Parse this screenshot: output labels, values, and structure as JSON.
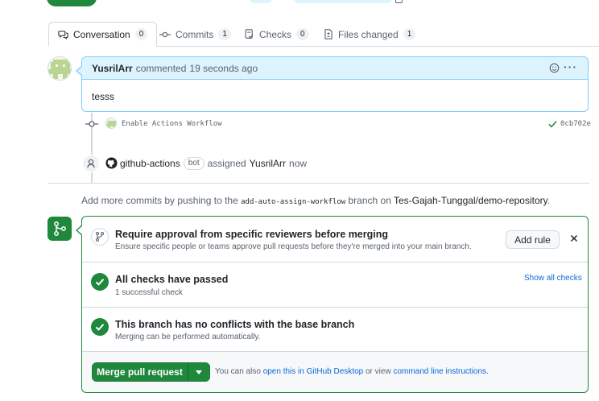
{
  "tabs": [
    {
      "label": "Conversation",
      "count": "0",
      "icon": "comment-discussion-icon"
    },
    {
      "label": "Commits",
      "count": "1",
      "icon": "git-commit-icon"
    },
    {
      "label": "Checks",
      "count": "0",
      "icon": "checklist-icon"
    },
    {
      "label": "Files changed",
      "count": "1",
      "icon": "file-diff-icon"
    }
  ],
  "comment": {
    "author": "YusrilArr",
    "action": "commented",
    "time": "19 seconds ago",
    "body": "tesss"
  },
  "commit": {
    "message": "Enable Actions Workflow",
    "sha": "0cb702e",
    "status": "success"
  },
  "assign_event": {
    "actor": "github-actions",
    "actor_badge": "bot",
    "action": "assigned",
    "assignee": "YusrilArr",
    "time": "now"
  },
  "push_info": {
    "prefix": "Add more commits by pushing to the",
    "branch": "add-auto-assign-workflow",
    "middle": "branch on",
    "repo": "Tes-Gajah-Tunggal/demo-repository",
    "suffix": "."
  },
  "merge_box": {
    "rule_title": "Require approval from specific reviewers before merging",
    "rule_sub": "Ensure specific people or teams approve pull requests before they're merged into your main branch.",
    "add_rule_label": "Add rule",
    "checks_title": "All checks have passed",
    "checks_sub": "1 successful check",
    "show_all_label": "Show all checks",
    "conflict_title": "This branch has no conflicts with the base branch",
    "conflict_sub": "Merging can be performed automatically.",
    "merge_button_label": "Merge pull request",
    "footer_prefix": "You can also",
    "footer_link1": "open this in GitHub Desktop",
    "footer_middle": "or view",
    "footer_link2": "command line instructions",
    "footer_suffix": "."
  },
  "colors": {
    "accent_green": "#1f883d",
    "link_blue": "#0969da",
    "comment_header_bg": "#ddf4ff",
    "comment_border": "#80ccff"
  }
}
